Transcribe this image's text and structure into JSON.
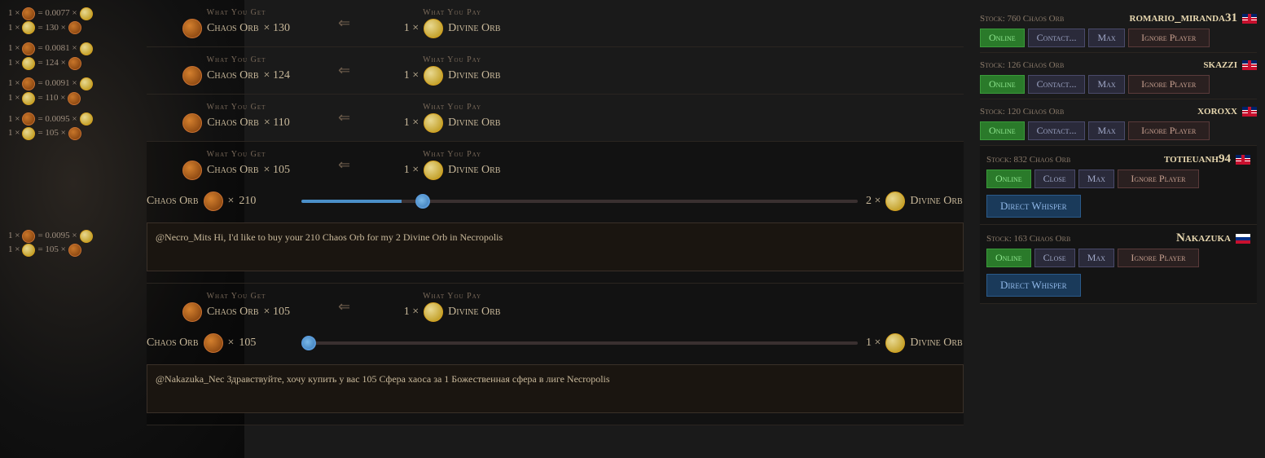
{
  "bg": {
    "description": "Dark fantasy background with character"
  },
  "listings": [
    {
      "id": 1,
      "ratio_line1": "1 × = 0.0077 ×",
      "ratio_line2": "1 × = 130 ×",
      "what_you_get_label": "What You Get",
      "what_you_pay_label": "What You Pay",
      "get_item": "Chaos Orb",
      "get_amount": "130",
      "pay_item": "Divine Orb",
      "pay_amount": "1",
      "stock_label": "Stock: 760 Chaos Orb",
      "seller": "romario_miranda31",
      "seller_flag": "gb",
      "status": "Online",
      "btn_contact": "Contact...",
      "btn_max": "Max",
      "btn_ignore": "Ignore Player",
      "expanded": false
    },
    {
      "id": 2,
      "ratio_line1": "1 × = 0.0081 ×",
      "ratio_line2": "1 × = 124 ×",
      "what_you_get_label": "What You Get",
      "what_you_pay_label": "What You Pay",
      "get_item": "Chaos Orb",
      "get_amount": "124",
      "pay_item": "Divine Orb",
      "pay_amount": "1",
      "stock_label": "Stock: 126 Chaos Orb",
      "seller": "skazzi",
      "seller_flag": "gb",
      "status": "Online",
      "btn_contact": "Contact...",
      "btn_max": "Max",
      "btn_ignore": "Ignore Player",
      "expanded": false
    },
    {
      "id": 3,
      "ratio_line1": "1 × = 0.0091 ×",
      "ratio_line2": "1 × = 110 ×",
      "what_you_get_label": "What You Get",
      "what_you_pay_label": "What You Pay",
      "get_item": "Chaos Orb",
      "get_amount": "110",
      "pay_item": "Divine Orb",
      "pay_amount": "1",
      "stock_label": "Stock: 120 Chaos Orb",
      "seller": "xoroxx",
      "seller_flag": "gb",
      "status": "Online",
      "btn_contact": "Contact...",
      "btn_max": "Max",
      "btn_ignore": "Ignore Player",
      "expanded": false
    },
    {
      "id": 4,
      "ratio_line1": "1 × = 0.0095 ×",
      "ratio_line2": "1 × = 105 ×",
      "what_you_get_label": "What You Get",
      "what_you_pay_label": "What You Pay",
      "get_item": "Chaos Orb",
      "get_amount": "105",
      "pay_item": "Divine Orb",
      "pay_amount": "1",
      "stock_label": "Stock: 832 Chaos Orb",
      "seller": "totieuanh94",
      "seller_flag": "gb",
      "status": "Online",
      "btn_close": "Close",
      "btn_max": "Max",
      "btn_ignore": "Ignore Player",
      "expanded": true,
      "slider_label": "Chaos Orb",
      "slider_value": "210",
      "slider_fill": "18%",
      "divine_count": "2",
      "divine_label": "Divine Orb",
      "message": "@Necro_Mits Hi, I'd like to buy your 210 Chaos Orb for my 2 Divine Orb in Necropolis",
      "btn_whisper": "Direct Whisper"
    },
    {
      "id": 5,
      "ratio_line1": "1 × = 0.0095 ×",
      "ratio_line2": "1 × = 105 ×",
      "what_you_get_label": "What You Get",
      "what_you_pay_label": "What You Pay",
      "get_item": "Chaos Orb",
      "get_amount": "105",
      "pay_item": "Divine Orb",
      "pay_amount": "1",
      "stock_label": "Stock: 163 Chaos Orb",
      "seller": "Nakazuka",
      "seller_flag": "ru",
      "status": "Online",
      "btn_close": "Close",
      "btn_max": "Max",
      "btn_ignore": "Ignore Player",
      "expanded": true,
      "slider_label": "Chaos Orb",
      "slider_value": "105",
      "slider_fill": "0%",
      "divine_count": "1",
      "divine_label": "Divine Orb",
      "message": "@Nakazuka_Nec Здравствуйте, хочу купить у вас 105 Сфера хаоса за 1 Божественная сфера в лиге Necropolis",
      "btn_whisper": "Direct Whisper"
    }
  ],
  "ui": {
    "arrow": "⇐",
    "multiply": "×"
  }
}
